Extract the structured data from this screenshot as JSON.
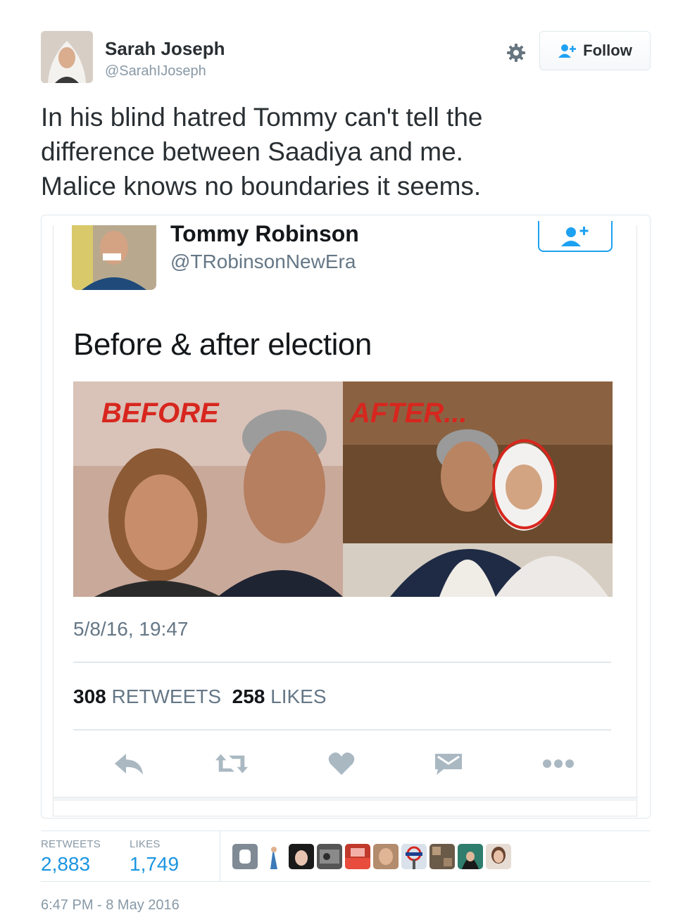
{
  "author": {
    "name": "Sarah Joseph",
    "handle": "@SarahIJoseph",
    "follow_label": "Follow"
  },
  "tweet": {
    "text_lines": [
      "In his blind hatred Tommy can't tell the",
      "difference between Saadiya and me.",
      "Malice knows no boundaries it seems."
    ]
  },
  "quoted": {
    "name": "Tommy Robinson",
    "handle": "@TRobinsonNewEra",
    "text": "Before & after election",
    "image_labels": {
      "before": "BEFORE",
      "after": "AFTER..."
    },
    "date": "5/8/16, 19:47",
    "retweets_count": "308",
    "retweets_label": "RETWEETS",
    "likes_count": "258",
    "likes_label": "LIKES",
    "actions": [
      "reply-icon",
      "retweet-icon",
      "like-icon",
      "message-icon",
      "more-icon"
    ]
  },
  "stats": {
    "retweets_label": "RETWEETS",
    "retweets_value": "2,883",
    "likes_label": "LIKES",
    "likes_value": "1,749",
    "liker_count": 10
  },
  "timestamp": "6:47 PM - 8 May 2016",
  "colors": {
    "accent_blue": "#1b95e0",
    "twitter_blue": "#1da1f2",
    "text_dark": "#292f33",
    "text_muted": "#8899a6",
    "border": "#e1e8ed",
    "before_after_red": "#d7261e"
  }
}
